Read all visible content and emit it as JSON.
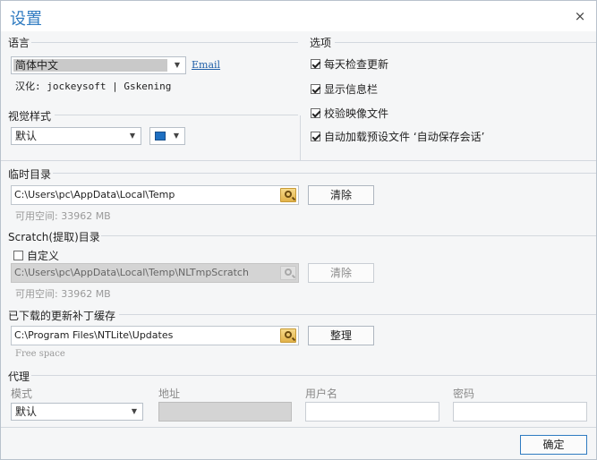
{
  "window": {
    "title": "设置",
    "close_glyph": "×"
  },
  "language": {
    "section_label": "语言",
    "selected": "简体中文",
    "email_link": "Email",
    "credit": "汉化: jockeysoft | Gskening"
  },
  "visual_style": {
    "section_label": "视觉样式",
    "selected": "默认",
    "accent_color": "#1e6fc1"
  },
  "options": {
    "section_label": "选项",
    "items": [
      {
        "label": "每天检查更新",
        "checked": true
      },
      {
        "label": "显示信息栏",
        "checked": true
      },
      {
        "label": "校验映像文件",
        "checked": true
      },
      {
        "label": "自动加载预设文件 ‘自动保存会话’",
        "checked": true
      }
    ]
  },
  "temp_dir": {
    "section_label": "临时目录",
    "path": "C:\\Users\\pc\\AppData\\Local\\Temp",
    "clear_label": "清除",
    "free_space": "可用空间: 33962 MB"
  },
  "scratch_dir": {
    "section_label": "Scratch(提取)目录",
    "custom_label": "自定义",
    "custom_checked": false,
    "path": "C:\\Users\\pc\\AppData\\Local\\Temp\\NLTmpScratch",
    "clear_label": "清除",
    "free_space": "可用空间: 33962 MB"
  },
  "update_cache": {
    "section_label": "已下载的更新补丁缓存",
    "path": "C:\\Program Files\\NTLite\\Updates",
    "organize_label": "整理",
    "free_space": "Free space"
  },
  "proxy": {
    "section_label": "代理",
    "mode_label": "模式",
    "mode_value": "默认",
    "address_label": "地址",
    "username_label": "用户名",
    "password_label": "密码"
  },
  "footer": {
    "ok_label": "确定"
  },
  "icons": {
    "close": "close-icon",
    "browse": "folder-search-icon",
    "dropdown": "chevron-down-icon"
  }
}
